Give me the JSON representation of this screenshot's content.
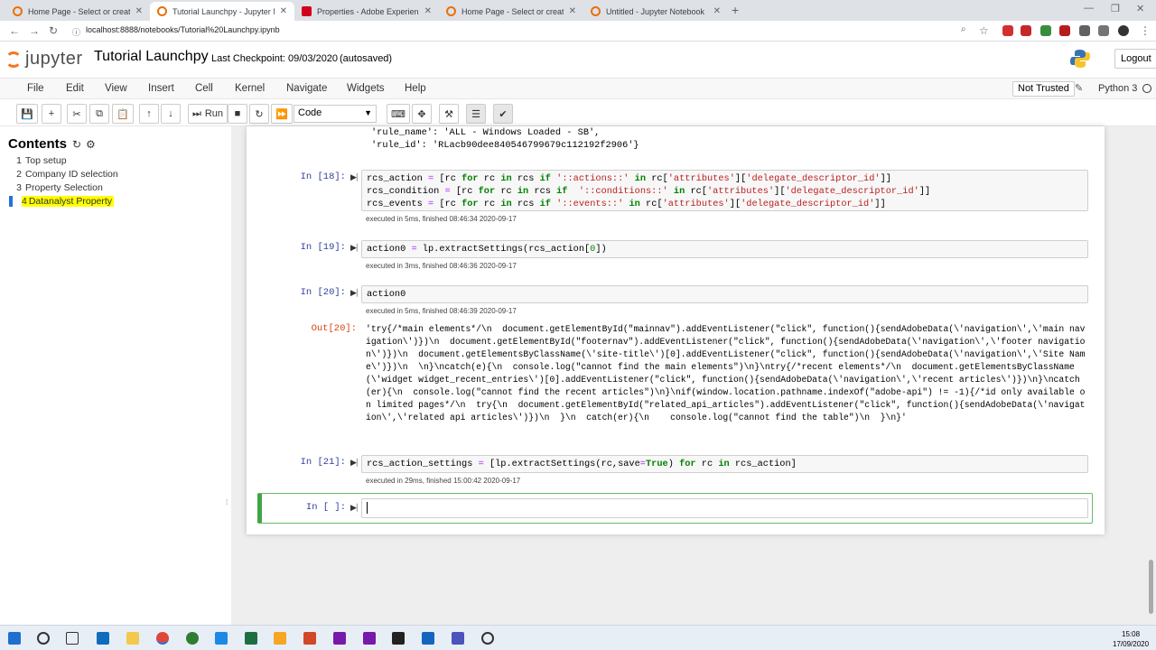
{
  "browser": {
    "tabs": [
      {
        "label": "Home Page - Select or create a n",
        "favicon_color": "#e8710a",
        "active": false
      },
      {
        "label": "Tutorial Launchpy - Jupyter Note",
        "favicon_color": "#e8710a",
        "active": true
      },
      {
        "label": "Properties - Adobe Experience P",
        "favicon_color": "#d0021b",
        "active": false
      },
      {
        "label": "Home Page - Select or create a n",
        "favicon_color": "#e8710a",
        "active": false
      },
      {
        "label": "Untitled - Jupyter Notebook",
        "favicon_color": "#e8710a",
        "active": false
      }
    ],
    "url": "localhost:8888/notebooks/Tutorial%20Launchpy.ipynb"
  },
  "header": {
    "logo_text": "jupyter",
    "notebook_title": "Tutorial Launchpy",
    "checkpoint": "Last Checkpoint: 09/03/2020",
    "autosaved": "(autosaved)",
    "logout": "Logout"
  },
  "menubar": {
    "items": [
      "File",
      "Edit",
      "View",
      "Insert",
      "Cell",
      "Kernel",
      "Navigate",
      "Widgets",
      "Help"
    ],
    "trust": "Not Trusted",
    "kernel": "Python 3"
  },
  "toolbar": {
    "run_label": "Run",
    "cell_type": "Code"
  },
  "toc": {
    "title": "Contents",
    "items": [
      {
        "num": "1",
        "label": "Top setup"
      },
      {
        "num": "2",
        "label": "Company ID selection"
      },
      {
        "num": "3",
        "label": "Property Selection"
      },
      {
        "num": "4",
        "label": "Datanalyst Property"
      }
    ]
  },
  "notebook": {
    "prev_output": {
      "line1a": "'rule_name': ",
      "line1b": "'ALL - Windows Loaded - SB',",
      "line2a": "'rule_id': ",
      "line2b": "'RLacb90dee840546799679c112192f2906'}"
    },
    "cells": [
      {
        "prompt": "In [18]:",
        "line1": [
          "rcs_action ",
          "= ",
          "[rc ",
          "for ",
          "rc ",
          "in ",
          "rcs ",
          "if ",
          "'::actions::' ",
          "in ",
          "rc[",
          "'attributes'",
          "][",
          "'delegate_descriptor_id'",
          "]]"
        ],
        "line2": [
          "rcs_condition ",
          "= ",
          "[rc ",
          "for ",
          "rc ",
          "in ",
          "rcs ",
          "if  ",
          "'::conditions::' ",
          "in ",
          "rc[",
          "'attributes'",
          "][",
          "'delegate_descriptor_id'",
          "]]"
        ],
        "line3": [
          "rcs_events ",
          "= ",
          "[rc ",
          "for ",
          "rc ",
          "in ",
          "rcs ",
          "if ",
          "'::events::' ",
          "in ",
          "rc[",
          "'attributes'",
          "][",
          "'delegate_descriptor_id'",
          "]]"
        ],
        "exec": "executed in 5ms, finished 08:46:34 2020-09-17"
      },
      {
        "prompt": "In [19]:",
        "line1": [
          "action0 ",
          "= ",
          "lp.extractSettings(rcs_action[",
          "0",
          "])"
        ],
        "exec": "executed in 3ms, finished 08:46:36 2020-09-17"
      },
      {
        "prompt": "In [20]:",
        "line1": [
          "action0"
        ],
        "exec": "executed in 5ms, finished 08:46:39 2020-09-17",
        "out_prompt": "Out[20]:",
        "output": "'try{/*main elements*/\\n  document.getElementById(\"mainnav\").addEventListener(\"click\", function(){sendAdobeData(\\'navigation\\',\\'main navigation\\')})\\n  document.getElementById(\"footernav\").addEventListener(\"click\", function(){sendAdobeData(\\'navigation\\',\\'footer navigation\\')})\\n  document.getElementsByClassName(\\'site-title\\')[0].addEventListener(\"click\", function(){sendAdobeData(\\'navigation\\',\\'Site Name\\')})\\n  \\n}\\ncatch(e){\\n  console.log(\"cannot find the main elements\")\\n}\\ntry{/*recent elements*/\\n  document.getElementsByClassName(\\'widget widget_recent_entries\\')[0].addEventListener(\"click\", function(){sendAdobeData(\\'navigation\\',\\'recent articles\\')})\\n}\\ncatch(er){\\n  console.log(\"cannot find the recent articles\")\\n}\\nif(window.location.pathname.indexOf(\"adobe-api\") != -1){/*id only available on limited pages*/\\n  try{\\n  document.getElementById(\"related_api_articles\").addEventListener(\"click\", function(){sendAdobeData(\\'navigation\\',\\'related api articles\\')})\\n  }\\n  catch(er){\\n    console.log(\"cannot find the table\")\\n  }\\n}'"
      },
      {
        "prompt": "In [21]:",
        "line1": [
          "rcs_action_settings ",
          "= ",
          "[lp.extractSettings(rc,save",
          "=",
          "True",
          ") ",
          "for ",
          "rc ",
          "in ",
          "rcs_action]"
        ],
        "exec": "executed in 29ms, finished 15:00:42 2020-09-17"
      },
      {
        "prompt": "In [ ]:"
      }
    ]
  },
  "taskbar": {
    "time": "15:08",
    "date": "17/09/2020"
  }
}
